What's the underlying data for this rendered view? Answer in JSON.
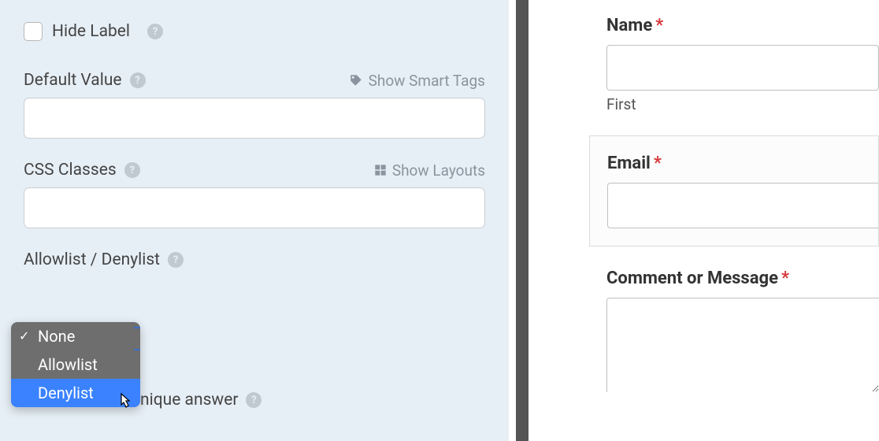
{
  "leftPanel": {
    "hideLabel": {
      "label": "Hide Label"
    },
    "defaultValue": {
      "label": "Default Value",
      "link": "Show Smart Tags"
    },
    "cssClasses": {
      "label": "CSS Classes",
      "link": "Show Layouts"
    },
    "allowDenylist": {
      "label": "Allowlist / Denylist"
    },
    "dropdown": {
      "items": [
        {
          "label": "None",
          "selected": true
        },
        {
          "label": "Allowlist",
          "selected": false
        },
        {
          "label": "Denylist",
          "selected": false
        }
      ]
    },
    "uniqueAnswer": {
      "fragment": "nique answer"
    }
  },
  "rightPanel": {
    "name": {
      "label": "Name",
      "sublabel": "First"
    },
    "email": {
      "label": "Email"
    },
    "comment": {
      "label": "Comment or Message"
    }
  }
}
